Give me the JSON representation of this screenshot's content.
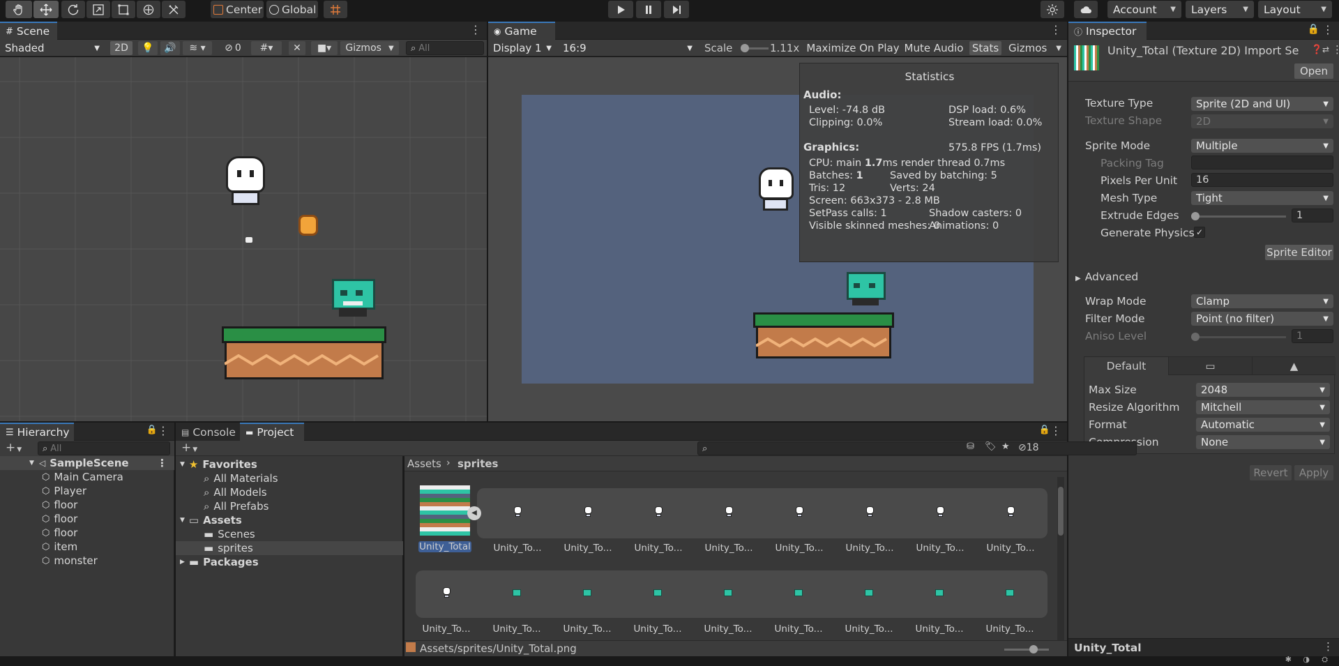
{
  "toolbar": {
    "pivot": "Center",
    "space": "Global",
    "account": "Account",
    "layers": "Layers",
    "layout": "Layout"
  },
  "scene": {
    "tab": "Scene",
    "shading": "Shaded",
    "mode2d": "2D",
    "hidden_count": "0",
    "gizmos": "Gizmos",
    "search_placeholder": "All"
  },
  "game": {
    "tab": "Game",
    "display": "Display 1",
    "aspect": "16:9",
    "scale_label": "Scale",
    "scale_value": "1.11x",
    "maximize": "Maximize On Play",
    "mute": "Mute Audio",
    "stats": "Stats",
    "gizmos": "Gizmos"
  },
  "stats": {
    "title": "Statistics",
    "audio_header": "Audio:",
    "level": "Level: -74.8 dB",
    "clipping": "Clipping: 0.0%",
    "dsp": "DSP load: 0.6%",
    "stream": "Stream load: 0.0%",
    "graphics_header": "Graphics:",
    "fps": "575.8 FPS (1.7ms)",
    "cpu_prefix": "CPU: main ",
    "cpu_main": "1.7",
    "cpu_suffix": "ms  render thread 0.7ms",
    "batches_prefix": "Batches: ",
    "batches": "1",
    "saved": "Saved by batching: 5",
    "tris": "Tris: 12",
    "verts": "Verts: 24",
    "screen": "Screen: 663x373 - 2.8 MB",
    "setpass": "SetPass calls: 1",
    "shadow": "Shadow casters: 0",
    "skinned": "Visible skinned meshes: 0",
    "animations": "Animations: 0"
  },
  "inspector": {
    "tab": "Inspector",
    "title": "Unity_Total (Texture 2D) Import Se",
    "open": "Open",
    "rows": {
      "texture_type": "Texture Type",
      "texture_type_val": "Sprite (2D and UI)",
      "texture_shape": "Texture Shape",
      "texture_shape_val": "2D",
      "sprite_mode": "Sprite Mode",
      "sprite_mode_val": "Multiple",
      "packing_tag": "Packing Tag",
      "ppu": "Pixels Per Unit",
      "ppu_val": "16",
      "mesh_type": "Mesh Type",
      "mesh_type_val": "Tight",
      "extrude": "Extrude Edges",
      "extrude_val": "1",
      "gen_physics": "Generate Physics",
      "sprite_editor": "Sprite Editor",
      "advanced": "Advanced",
      "wrap_mode": "Wrap Mode",
      "wrap_mode_val": "Clamp",
      "filter_mode": "Filter Mode",
      "filter_mode_val": "Point (no filter)",
      "aniso": "Aniso Level",
      "aniso_val": "1"
    },
    "platform": {
      "default_tab": "Default",
      "max_size": "Max Size",
      "max_size_val": "2048",
      "resize": "Resize Algorithm",
      "resize_val": "Mitchell",
      "format": "Format",
      "format_val": "Automatic",
      "compression": "Compression",
      "compression_val": "None"
    },
    "revert": "Revert",
    "apply": "Apply",
    "footer": "Unity_Total"
  },
  "hierarchy": {
    "tab": "Hierarchy",
    "search_placeholder": "All",
    "scene": "SampleScene",
    "items": [
      "Main Camera",
      "Player",
      "floor",
      "floor",
      "floor",
      "item",
      "monster"
    ]
  },
  "project": {
    "console_tab": "Console",
    "project_tab": "Project",
    "hidden_count": "18",
    "favorites": "Favorites",
    "fav_items": [
      "All Materials",
      "All Models",
      "All Prefabs"
    ],
    "assets": "Assets",
    "asset_items": [
      "Scenes",
      "sprites"
    ],
    "packages": "Packages",
    "breadcrumb_root": "Assets",
    "breadcrumb_leaf": "sprites",
    "main_asset": "Unity_Total",
    "row1": [
      "Unity_To...",
      "Unity_To...",
      "Unity_To...",
      "Unity_To...",
      "Unity_To...",
      "Unity_To...",
      "Unity_To...",
      "Unity_To..."
    ],
    "row2": [
      "Unity_To...",
      "Unity_To...",
      "Unity_To...",
      "Unity_To...",
      "Unity_To...",
      "Unity_To...",
      "Unity_To...",
      "Unity_To...",
      "Unity_To..."
    ],
    "path": "Assets/sprites/Unity_Total.png"
  },
  "colors": {
    "accent": "#3a79bb",
    "game_bg": "#54627d",
    "grass": "#2a8f45",
    "dirt": "#c27b4a",
    "monster": "#2ec4a5"
  }
}
